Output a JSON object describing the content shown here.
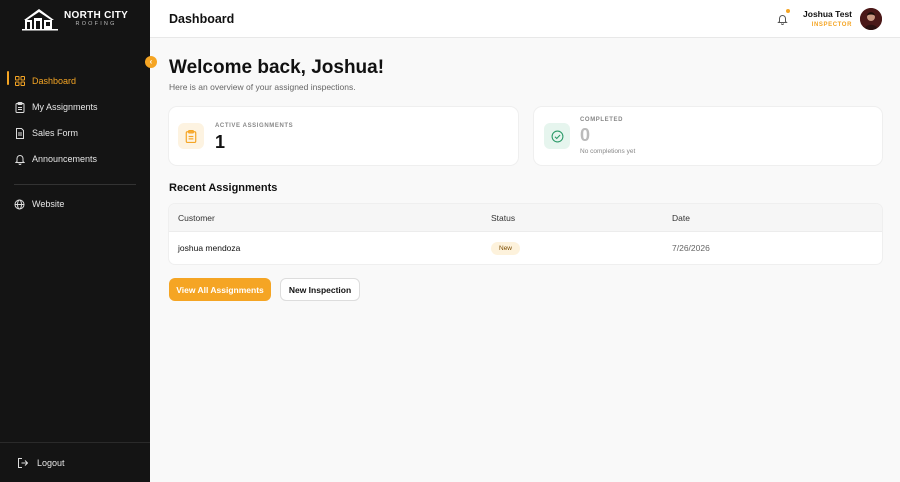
{
  "brand": {
    "title": "NORTH CITY",
    "subtitle": "ROOFING",
    "accent": "#f5a524",
    "sidebar_bg": "#141414"
  },
  "sidebar": {
    "collapse_icon": "chevron-left-icon",
    "items": [
      {
        "label": "Dashboard",
        "icon": "grid-icon",
        "active": true
      },
      {
        "label": "My Assignments",
        "icon": "clipboard-icon",
        "active": false
      },
      {
        "label": "Sales Form",
        "icon": "document-icon",
        "active": false
      },
      {
        "label": "Announcements",
        "icon": "bell-icon",
        "active": false
      }
    ],
    "secondary": [
      {
        "label": "Website",
        "icon": "globe-icon"
      }
    ],
    "logout_label": "Logout"
  },
  "header": {
    "title": "Dashboard",
    "user_name": "Joshua Test",
    "user_role": "INSPECTOR"
  },
  "main": {
    "welcome": "Welcome back, Joshua!",
    "subtitle": "Here is an overview of your assigned inspections.",
    "stats": [
      {
        "label": "ACTIVE ASSIGNMENTS",
        "value": "1",
        "note": ""
      },
      {
        "label": "COMPLETED",
        "value": "0",
        "note": "No completions yet"
      }
    ],
    "recent_title": "Recent Assignments",
    "table": {
      "columns": [
        "Customer",
        "Status",
        "Date"
      ],
      "rows": [
        {
          "customer": "joshua mendoza",
          "status": "New",
          "date": "7/26/2026"
        }
      ]
    },
    "buttons": {
      "primary": "View All Assignments",
      "secondary": "New Inspection"
    }
  }
}
